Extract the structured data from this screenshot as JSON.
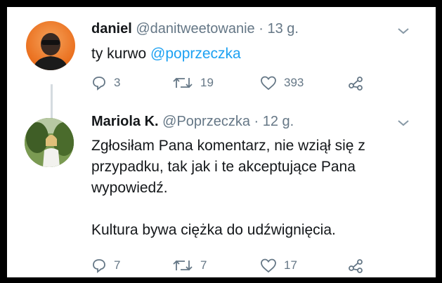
{
  "tweets": [
    {
      "name": "daniel",
      "handle": "@danitweetowanie",
      "separator": "·",
      "time": "13 g.",
      "text_plain": "ty kurwo ",
      "text_mention": "@poprzeczka",
      "replies": "3",
      "retweets": "19",
      "likes": "393",
      "avatar_color": "#ea6f1e"
    },
    {
      "name": "Mariola K.",
      "handle": "@Poprzeczka",
      "separator": "·",
      "time": "12 g.",
      "lines": [
        "Zgłosiłam Pana komentarz, nie wziął się z",
        "przypadku, tak jak i te akceptujące Pana",
        "wypowiedź.",
        "",
        "Kultura bywa ciężka do udźwignięcia."
      ],
      "replies": "7",
      "retweets": "7",
      "likes": "17"
    }
  ],
  "icons": [
    "chevron-down-icon",
    "reply-icon",
    "retweet-icon",
    "like-icon",
    "share-icon"
  ],
  "colors": {
    "link": "#1da1f2",
    "secondary": "#657786",
    "text": "#14171a"
  }
}
